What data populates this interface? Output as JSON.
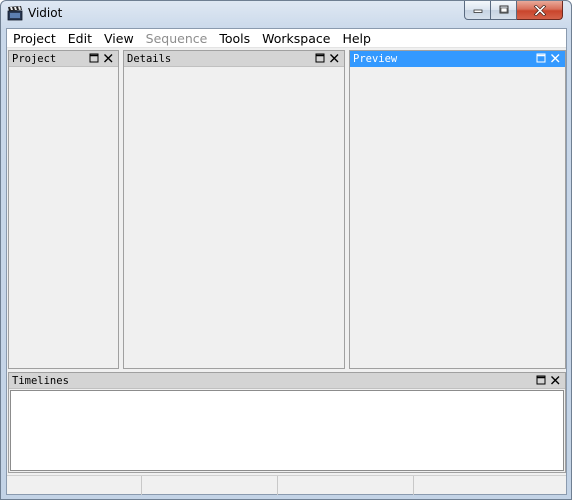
{
  "window": {
    "title": "Vidiot"
  },
  "menubar": {
    "items": [
      {
        "label": "Project",
        "disabled": false
      },
      {
        "label": "Edit",
        "disabled": false
      },
      {
        "label": "View",
        "disabled": false
      },
      {
        "label": "Sequence",
        "disabled": true
      },
      {
        "label": "Tools",
        "disabled": false
      },
      {
        "label": "Workspace",
        "disabled": false
      },
      {
        "label": "Help",
        "disabled": false
      }
    ]
  },
  "panels": {
    "project": {
      "title": "Project"
    },
    "details": {
      "title": "Details"
    },
    "preview": {
      "title": "Preview",
      "active": true
    },
    "timelines": {
      "title": "Timelines"
    }
  },
  "colors": {
    "active_header": "#3399ff",
    "inactive_header": "#d4d4d4",
    "panel_bg": "#f0f0f0",
    "close_button": "#c9452c"
  },
  "icons": {
    "app": "clapperboard-icon",
    "minimize": "minimize-icon",
    "maximize": "maximize-icon",
    "close": "close-icon",
    "panel_maximize": "panel-maximize-icon",
    "panel_close": "panel-close-icon"
  }
}
